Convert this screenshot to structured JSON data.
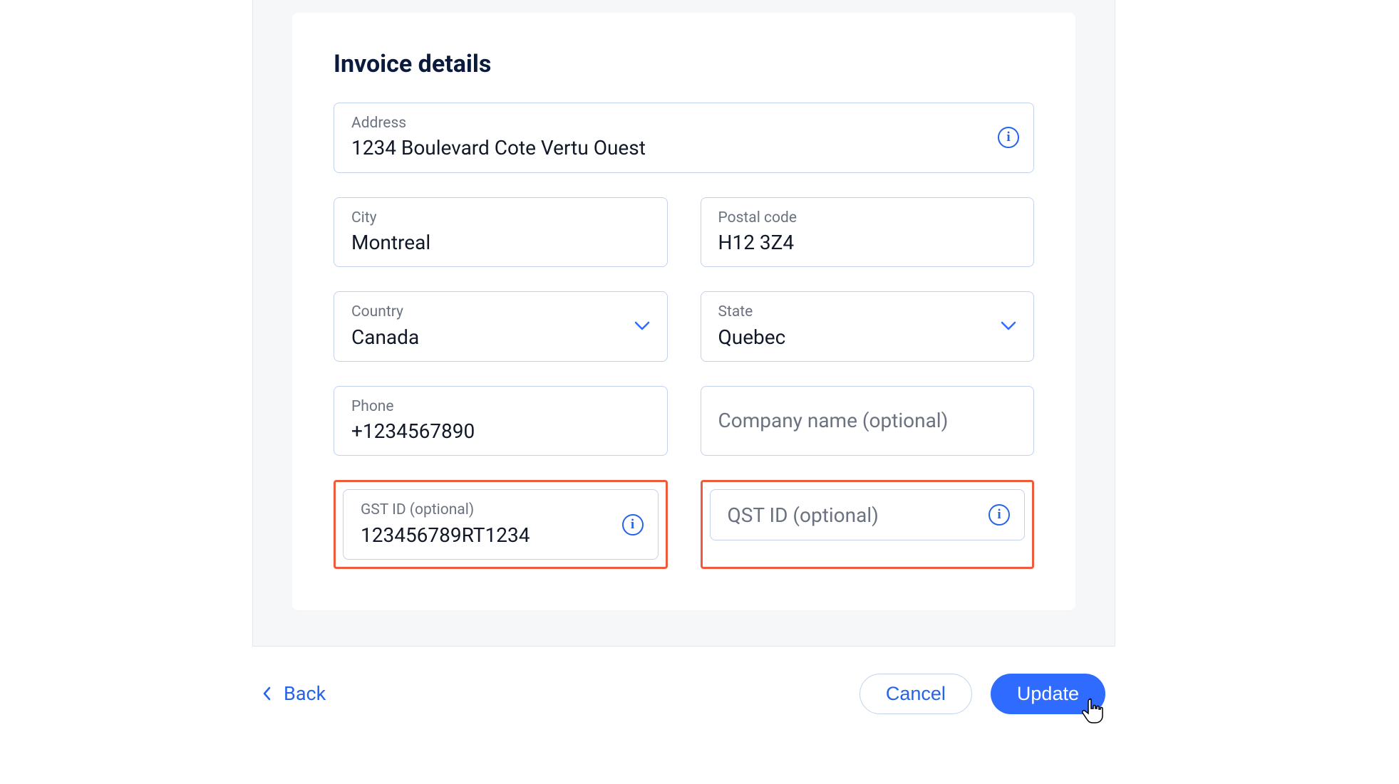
{
  "title": "Invoice details",
  "fields": {
    "address": {
      "label": "Address",
      "value": "1234 Boulevard Cote Vertu Ouest"
    },
    "city": {
      "label": "City",
      "value": "Montreal"
    },
    "postal": {
      "label": "Postal code",
      "value": "H12 3Z4"
    },
    "country": {
      "label": "Country",
      "value": "Canada"
    },
    "state": {
      "label": "State",
      "value": "Quebec"
    },
    "phone": {
      "label": "Phone",
      "value": "+1234567890"
    },
    "company": {
      "placeholder": "Company name (optional)",
      "value": ""
    },
    "gst": {
      "label": "GST ID (optional)",
      "value": "123456789RT1234"
    },
    "qst": {
      "placeholder": "QST ID (optional)",
      "value": ""
    }
  },
  "footer": {
    "back": "Back",
    "cancel": "Cancel",
    "update": "Update"
  },
  "colors": {
    "accent": "#2f6bff",
    "highlight": "#ee5a3c",
    "border": "#c2d2ef"
  }
}
